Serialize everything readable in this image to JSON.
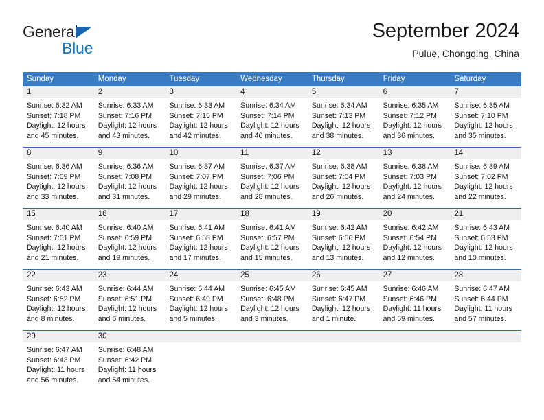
{
  "logo": {
    "primary_text": "General",
    "secondary_text": "Blue",
    "triangle_color": "#1565b0",
    "secondary_color": "#1579c4"
  },
  "header": {
    "title": "September 2024",
    "subtitle": "Pulue, Chongqing, China"
  },
  "theme": {
    "header_bar_color": "#3a7cc4",
    "row_divider_color": "#2f6fb3",
    "daynum_band_color": "#efefef",
    "text_color": "#1a1a1a"
  },
  "weekdays": [
    "Sunday",
    "Monday",
    "Tuesday",
    "Wednesday",
    "Thursday",
    "Friday",
    "Saturday"
  ],
  "weeks": [
    [
      {
        "day": "1",
        "sunrise": "Sunrise: 6:32 AM",
        "sunset": "Sunset: 7:18 PM",
        "daylight_1": "Daylight: 12 hours",
        "daylight_2": "and 45 minutes."
      },
      {
        "day": "2",
        "sunrise": "Sunrise: 6:33 AM",
        "sunset": "Sunset: 7:16 PM",
        "daylight_1": "Daylight: 12 hours",
        "daylight_2": "and 43 minutes."
      },
      {
        "day": "3",
        "sunrise": "Sunrise: 6:33 AM",
        "sunset": "Sunset: 7:15 PM",
        "daylight_1": "Daylight: 12 hours",
        "daylight_2": "and 42 minutes."
      },
      {
        "day": "4",
        "sunrise": "Sunrise: 6:34 AM",
        "sunset": "Sunset: 7:14 PM",
        "daylight_1": "Daylight: 12 hours",
        "daylight_2": "and 40 minutes."
      },
      {
        "day": "5",
        "sunrise": "Sunrise: 6:34 AM",
        "sunset": "Sunset: 7:13 PM",
        "daylight_1": "Daylight: 12 hours",
        "daylight_2": "and 38 minutes."
      },
      {
        "day": "6",
        "sunrise": "Sunrise: 6:35 AM",
        "sunset": "Sunset: 7:12 PM",
        "daylight_1": "Daylight: 12 hours",
        "daylight_2": "and 36 minutes."
      },
      {
        "day": "7",
        "sunrise": "Sunrise: 6:35 AM",
        "sunset": "Sunset: 7:10 PM",
        "daylight_1": "Daylight: 12 hours",
        "daylight_2": "and 35 minutes."
      }
    ],
    [
      {
        "day": "8",
        "sunrise": "Sunrise: 6:36 AM",
        "sunset": "Sunset: 7:09 PM",
        "daylight_1": "Daylight: 12 hours",
        "daylight_2": "and 33 minutes."
      },
      {
        "day": "9",
        "sunrise": "Sunrise: 6:36 AM",
        "sunset": "Sunset: 7:08 PM",
        "daylight_1": "Daylight: 12 hours",
        "daylight_2": "and 31 minutes."
      },
      {
        "day": "10",
        "sunrise": "Sunrise: 6:37 AM",
        "sunset": "Sunset: 7:07 PM",
        "daylight_1": "Daylight: 12 hours",
        "daylight_2": "and 29 minutes."
      },
      {
        "day": "11",
        "sunrise": "Sunrise: 6:37 AM",
        "sunset": "Sunset: 7:06 PM",
        "daylight_1": "Daylight: 12 hours",
        "daylight_2": "and 28 minutes."
      },
      {
        "day": "12",
        "sunrise": "Sunrise: 6:38 AM",
        "sunset": "Sunset: 7:04 PM",
        "daylight_1": "Daylight: 12 hours",
        "daylight_2": "and 26 minutes."
      },
      {
        "day": "13",
        "sunrise": "Sunrise: 6:38 AM",
        "sunset": "Sunset: 7:03 PM",
        "daylight_1": "Daylight: 12 hours",
        "daylight_2": "and 24 minutes."
      },
      {
        "day": "14",
        "sunrise": "Sunrise: 6:39 AM",
        "sunset": "Sunset: 7:02 PM",
        "daylight_1": "Daylight: 12 hours",
        "daylight_2": "and 22 minutes."
      }
    ],
    [
      {
        "day": "15",
        "sunrise": "Sunrise: 6:40 AM",
        "sunset": "Sunset: 7:01 PM",
        "daylight_1": "Daylight: 12 hours",
        "daylight_2": "and 21 minutes."
      },
      {
        "day": "16",
        "sunrise": "Sunrise: 6:40 AM",
        "sunset": "Sunset: 6:59 PM",
        "daylight_1": "Daylight: 12 hours",
        "daylight_2": "and 19 minutes."
      },
      {
        "day": "17",
        "sunrise": "Sunrise: 6:41 AM",
        "sunset": "Sunset: 6:58 PM",
        "daylight_1": "Daylight: 12 hours",
        "daylight_2": "and 17 minutes."
      },
      {
        "day": "18",
        "sunrise": "Sunrise: 6:41 AM",
        "sunset": "Sunset: 6:57 PM",
        "daylight_1": "Daylight: 12 hours",
        "daylight_2": "and 15 minutes."
      },
      {
        "day": "19",
        "sunrise": "Sunrise: 6:42 AM",
        "sunset": "Sunset: 6:56 PM",
        "daylight_1": "Daylight: 12 hours",
        "daylight_2": "and 13 minutes."
      },
      {
        "day": "20",
        "sunrise": "Sunrise: 6:42 AM",
        "sunset": "Sunset: 6:54 PM",
        "daylight_1": "Daylight: 12 hours",
        "daylight_2": "and 12 minutes."
      },
      {
        "day": "21",
        "sunrise": "Sunrise: 6:43 AM",
        "sunset": "Sunset: 6:53 PM",
        "daylight_1": "Daylight: 12 hours",
        "daylight_2": "and 10 minutes."
      }
    ],
    [
      {
        "day": "22",
        "sunrise": "Sunrise: 6:43 AM",
        "sunset": "Sunset: 6:52 PM",
        "daylight_1": "Daylight: 12 hours",
        "daylight_2": "and 8 minutes."
      },
      {
        "day": "23",
        "sunrise": "Sunrise: 6:44 AM",
        "sunset": "Sunset: 6:51 PM",
        "daylight_1": "Daylight: 12 hours",
        "daylight_2": "and 6 minutes."
      },
      {
        "day": "24",
        "sunrise": "Sunrise: 6:44 AM",
        "sunset": "Sunset: 6:49 PM",
        "daylight_1": "Daylight: 12 hours",
        "daylight_2": "and 5 minutes."
      },
      {
        "day": "25",
        "sunrise": "Sunrise: 6:45 AM",
        "sunset": "Sunset: 6:48 PM",
        "daylight_1": "Daylight: 12 hours",
        "daylight_2": "and 3 minutes."
      },
      {
        "day": "26",
        "sunrise": "Sunrise: 6:45 AM",
        "sunset": "Sunset: 6:47 PM",
        "daylight_1": "Daylight: 12 hours",
        "daylight_2": "and 1 minute."
      },
      {
        "day": "27",
        "sunrise": "Sunrise: 6:46 AM",
        "sunset": "Sunset: 6:46 PM",
        "daylight_1": "Daylight: 11 hours",
        "daylight_2": "and 59 minutes."
      },
      {
        "day": "28",
        "sunrise": "Sunrise: 6:47 AM",
        "sunset": "Sunset: 6:44 PM",
        "daylight_1": "Daylight: 11 hours",
        "daylight_2": "and 57 minutes."
      }
    ],
    [
      {
        "day": "29",
        "sunrise": "Sunrise: 6:47 AM",
        "sunset": "Sunset: 6:43 PM",
        "daylight_1": "Daylight: 11 hours",
        "daylight_2": "and 56 minutes."
      },
      {
        "day": "30",
        "sunrise": "Sunrise: 6:48 AM",
        "sunset": "Sunset: 6:42 PM",
        "daylight_1": "Daylight: 11 hours",
        "daylight_2": "and 54 minutes."
      },
      {
        "day": "",
        "sunrise": "",
        "sunset": "",
        "daylight_1": "",
        "daylight_2": ""
      },
      {
        "day": "",
        "sunrise": "",
        "sunset": "",
        "daylight_1": "",
        "daylight_2": ""
      },
      {
        "day": "",
        "sunrise": "",
        "sunset": "",
        "daylight_1": "",
        "daylight_2": ""
      },
      {
        "day": "",
        "sunrise": "",
        "sunset": "",
        "daylight_1": "",
        "daylight_2": ""
      },
      {
        "day": "",
        "sunrise": "",
        "sunset": "",
        "daylight_1": "",
        "daylight_2": ""
      }
    ]
  ]
}
